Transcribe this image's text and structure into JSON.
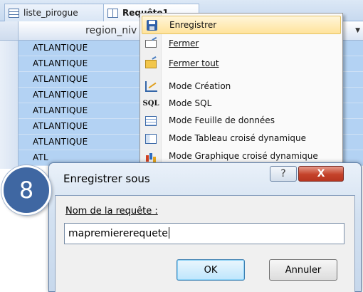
{
  "tabs": [
    {
      "label": "liste_pirogue",
      "icon": "table-icon"
    },
    {
      "label": "Requête1",
      "icon": "query-icon"
    }
  ],
  "datasheet": {
    "column_header": "region_niv",
    "rows": [
      "ATLANTIQUE",
      "ATLANTIQUE",
      "ATLANTIQUE",
      "ATLANTIQUE",
      "ATLANTIQUE",
      "ATLANTIQUE",
      "ATLANTIQUE"
    ],
    "partial_row": "ATL"
  },
  "context_menu": {
    "items": [
      {
        "label": "Enregistrer",
        "icon": "save-icon",
        "highlighted": true
      },
      {
        "label": "Fermer",
        "icon": "close-doc-icon"
      },
      {
        "label": "Fermer tout",
        "icon": "close-all-icon"
      },
      {
        "label": "Mode Création",
        "icon": "design-view-icon"
      },
      {
        "label": "Mode SQL",
        "icon": "sql-icon",
        "icon_text": "SQL"
      },
      {
        "label": "Mode Feuille de données",
        "icon": "datasheet-icon"
      },
      {
        "label": "Mode Tableau croisé dynamique",
        "icon": "pivot-table-icon"
      },
      {
        "label": "Mode Graphique croisé dynamique",
        "icon": "pivot-chart-icon"
      }
    ]
  },
  "dialog": {
    "title": "Enregistrer sous",
    "help_glyph": "?",
    "close_glyph": "X",
    "field_label": "Nom de la requête :",
    "field_value": "mapremiererequete",
    "ok_label": "OK",
    "cancel_label": "Annuler"
  },
  "step_badge": "8",
  "colors": {
    "row_highlight": "#b3d2f3",
    "menu_highlight": "#ffe39b",
    "badge": "#3f67a2",
    "close_button": "#c4422a"
  }
}
